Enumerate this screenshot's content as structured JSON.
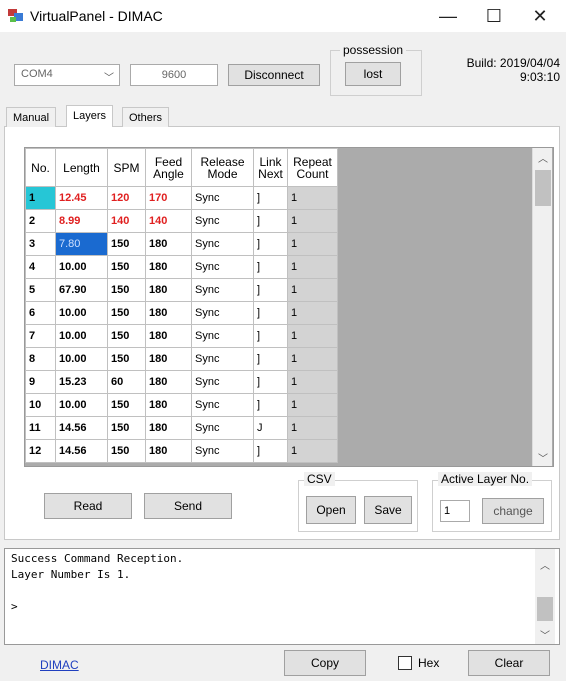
{
  "window": {
    "title": "VirtualPanel - DIMAC",
    "minimize": "—",
    "maximize": "☐",
    "close": "✕"
  },
  "toolbar": {
    "port": "COM4",
    "baud": "9600",
    "disconnect_label": "Disconnect",
    "possession_label": "possession",
    "possession_button": "lost",
    "build_line1": "Build: 2019/04/04",
    "build_line2": "9:03:10"
  },
  "tabs": [
    {
      "label": "Manual"
    },
    {
      "label": "Layers"
    },
    {
      "label": "Others"
    }
  ],
  "active_tab": "Layers",
  "grid": {
    "headers": [
      "No.",
      "Length",
      "SPM",
      "Feed Angle",
      "Release Mode",
      "Link Next",
      "Repeat Count"
    ],
    "rows": [
      [
        "1",
        "12.45",
        "120",
        "170",
        "Sync",
        "]",
        "1"
      ],
      [
        "2",
        "8.99",
        "140",
        "140",
        "Sync",
        "]",
        "1"
      ],
      [
        "3",
        "7.80",
        "150",
        "180",
        "Sync",
        "]",
        "1"
      ],
      [
        "4",
        "10.00",
        "150",
        "180",
        "Sync",
        "]",
        "1"
      ],
      [
        "5",
        "67.90",
        "150",
        "180",
        "Sync",
        "]",
        "1"
      ],
      [
        "6",
        "10.00",
        "150",
        "180",
        "Sync",
        "]",
        "1"
      ],
      [
        "7",
        "10.00",
        "150",
        "180",
        "Sync",
        "]",
        "1"
      ],
      [
        "8",
        "10.00",
        "150",
        "180",
        "Sync",
        "]",
        "1"
      ],
      [
        "9",
        "15.23",
        "60",
        "180",
        "Sync",
        "]",
        "1"
      ],
      [
        "10",
        "10.00",
        "150",
        "180",
        "Sync",
        "]",
        "1"
      ],
      [
        "11",
        "14.56",
        "150",
        "180",
        "Sync",
        "J",
        "1"
      ],
      [
        "12",
        "14.56",
        "150",
        "180",
        "Sync",
        "]",
        "1"
      ]
    ]
  },
  "buttons": {
    "read": "Read",
    "send": "Send"
  },
  "csv": {
    "label": "CSV",
    "open": "Open",
    "save": "Save"
  },
  "active_layer": {
    "label": "Active Layer No.",
    "value": "1",
    "change": "change"
  },
  "log": {
    "text": "Success Command Reception.\nLayer Number Is 1.\n\n>"
  },
  "footer": {
    "link": "DIMAC",
    "copy": "Copy",
    "hex": "Hex",
    "clear": "Clear"
  },
  "colors": {
    "accent_red": "#e02020",
    "selection_blue": "#1a6ad0",
    "row1_no": "#26c6d6"
  }
}
